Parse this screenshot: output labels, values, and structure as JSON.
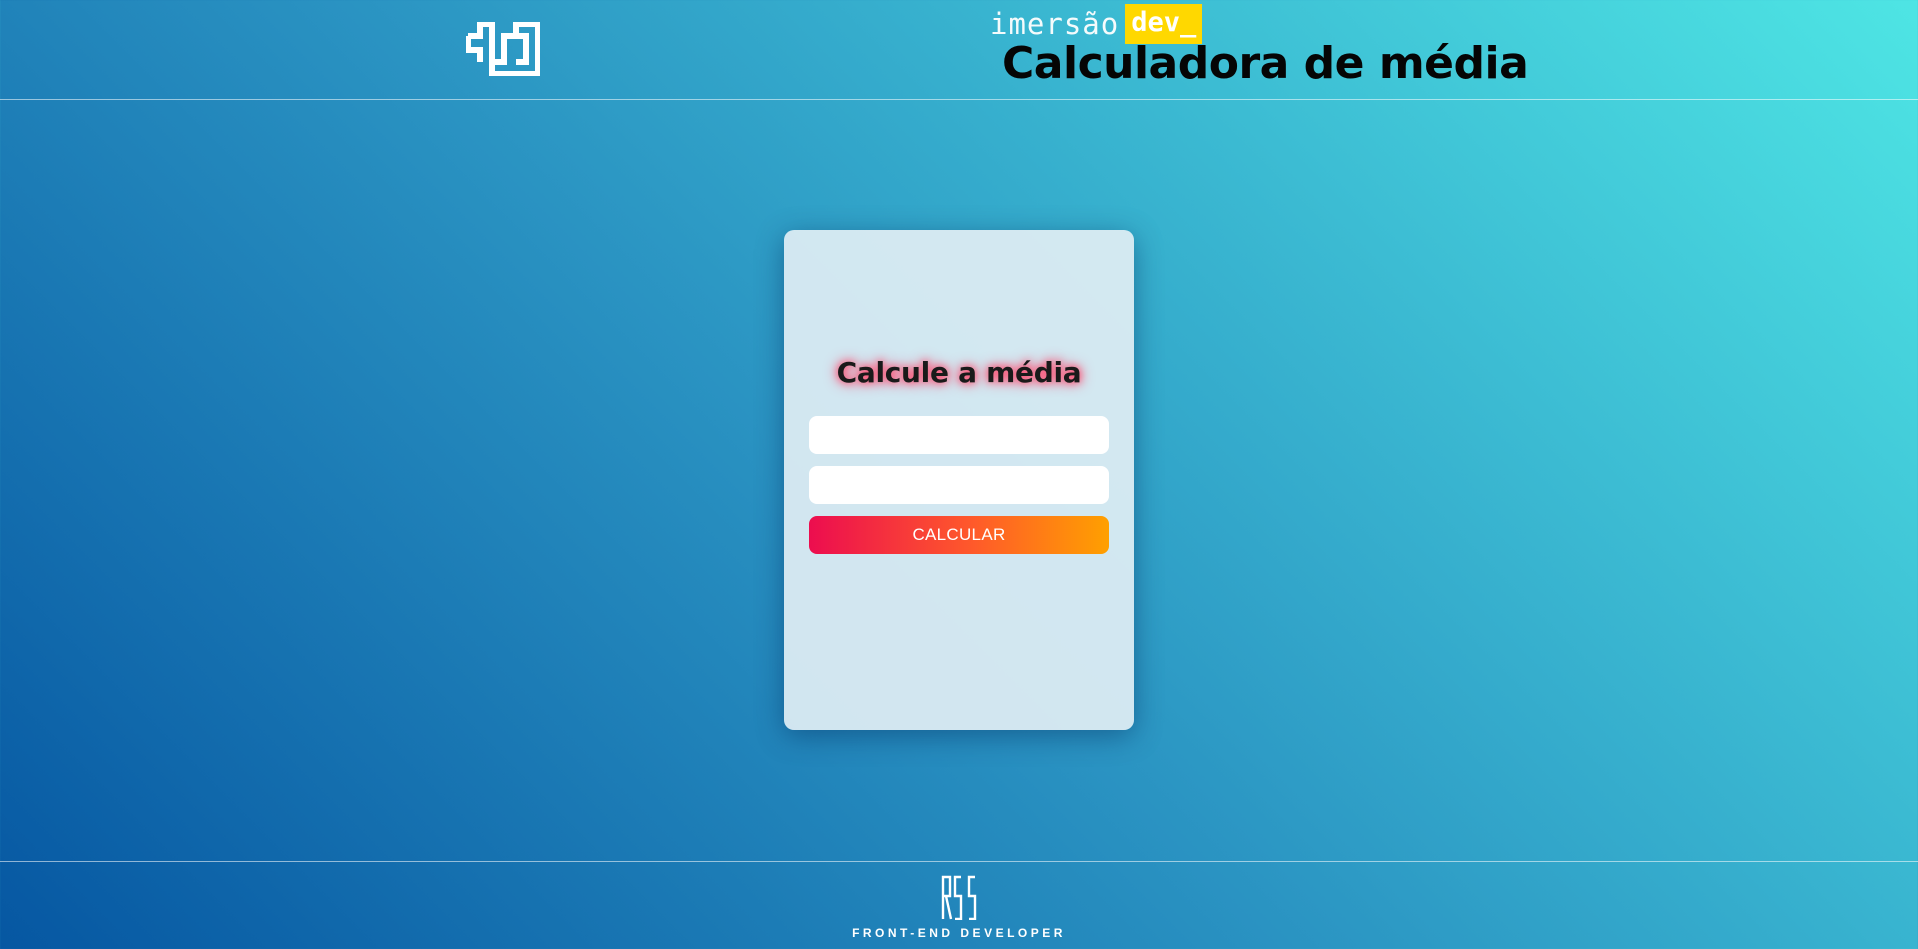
{
  "header": {
    "logo_icon": "maze-square-logo-icon",
    "brand_prefix": "imersão",
    "brand_badge": "dev_",
    "title": "Calculadora de média"
  },
  "card": {
    "title": "Calcule a média",
    "input_1": {
      "value": "",
      "placeholder": ""
    },
    "input_2": {
      "value": "",
      "placeholder": ""
    },
    "button_label": "CALCULAR"
  },
  "footer": {
    "logo_icon": "rss-monogram-logo-icon",
    "tagline": "FRONT-END DEVELOPER"
  },
  "colors": {
    "background_start": "#0657a2",
    "background_end": "#4ee5e4",
    "brand_badge": "#ffd800",
    "button_start": "#ec0d4f",
    "button_end": "#ffa000",
    "title_glow": "#ff4a6e"
  }
}
